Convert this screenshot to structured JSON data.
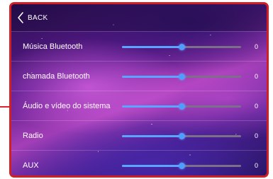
{
  "header": {
    "back_label": "BACK"
  },
  "rows": [
    {
      "label": "Música Bluetooth",
      "value": "0",
      "slider_fraction": 0.5
    },
    {
      "label": "chamada Bluetooth",
      "value": "0",
      "slider_fraction": 0.5
    },
    {
      "label": "Áudio e vídeo do sistema",
      "value": "0",
      "slider_fraction": 0.5
    },
    {
      "label": "Radio",
      "value": "0",
      "slider_fraction": 0.5
    },
    {
      "label": "AUX",
      "value": "0",
      "slider_fraction": 0.5
    }
  ],
  "colors": {
    "border": "#d11f25",
    "slider_fill": "#5aa5ff",
    "slider_thumb": "#4f9dff",
    "slider_track": "#7b6f8a"
  }
}
